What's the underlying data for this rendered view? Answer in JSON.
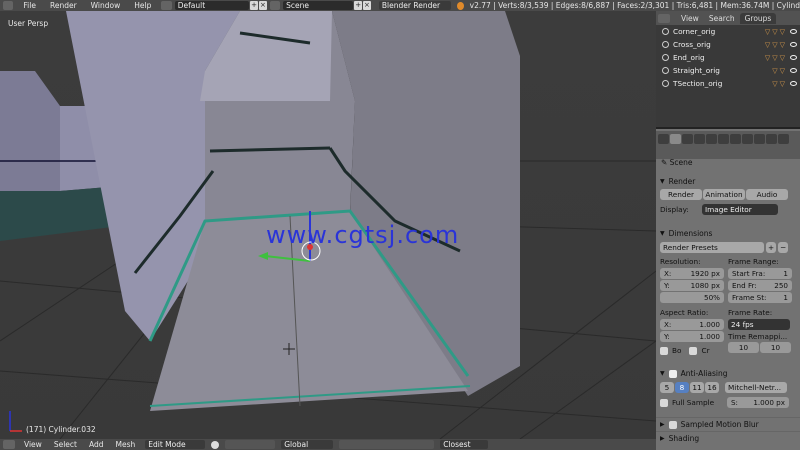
{
  "topbar": {
    "menus": [
      "File",
      "Render",
      "Window",
      "Help"
    ],
    "layout": "Default",
    "scene": "Scene",
    "engine": "Blender Render",
    "stats": "v2.77 | Verts:8/3,539 | Edges:8/6,887 | Faces:2/3,301 | Tris:6,481 | Mem:36.74M | Cylind"
  },
  "viewport": {
    "view_label": "User Persp",
    "object_label": "(171) Cylinder.032",
    "watermark": "www.cgtsj.com"
  },
  "bottombar": {
    "menus": [
      "View",
      "Select",
      "Add",
      "Mesh"
    ],
    "mode": "Edit Mode",
    "orientation": "Global",
    "snap": "Closest"
  },
  "outliner": {
    "tabs": [
      "View",
      "Search",
      "Groups"
    ],
    "active_tab": "Groups",
    "items": [
      "Corner_orig",
      "Cross_orig",
      "End_orig",
      "Straight_orig",
      "TSection_orig"
    ]
  },
  "properties": {
    "breadcrumb": "Scene",
    "render": {
      "title": "Render",
      "buttons": [
        "Render",
        "Animation",
        "Audio"
      ],
      "display_label": "Display:",
      "display_value": "Image Editor"
    },
    "dimensions": {
      "title": "Dimensions",
      "presets": "Render Presets",
      "resolution_label": "Resolution:",
      "res_x_label": "X:",
      "res_x": "1920 px",
      "res_y_label": "Y:",
      "res_y": "1080 px",
      "res_pct": "50%",
      "frame_range_label": "Frame Range:",
      "start_label": "Start Fra:",
      "start": "1",
      "end_label": "End Fr:",
      "end": "250",
      "step_label": "Frame St:",
      "step": "1",
      "aspect_label": "Aspect Ratio:",
      "asp_x_label": "X:",
      "asp_x": "1.000",
      "asp_y_label": "Y:",
      "asp_y": "1.000",
      "frame_rate_label": "Frame Rate:",
      "frame_rate": "24 fps",
      "time_remap_label": "Time Remappi...",
      "remap_old": "10",
      "remap_new": "10",
      "border_label": "Bo",
      "crop_label": "Cr"
    },
    "aa": {
      "title": "Anti-Aliasing",
      "samples": [
        "5",
        "8",
        "11",
        "16"
      ],
      "active_sample": "8",
      "filter": "Mitchell-Netr...",
      "full_sample": "Full Sample",
      "size_label": "S:",
      "size": "1.000 px"
    },
    "sampled_motion_blur": "Sampled Motion Blur",
    "shading": "Shading"
  }
}
